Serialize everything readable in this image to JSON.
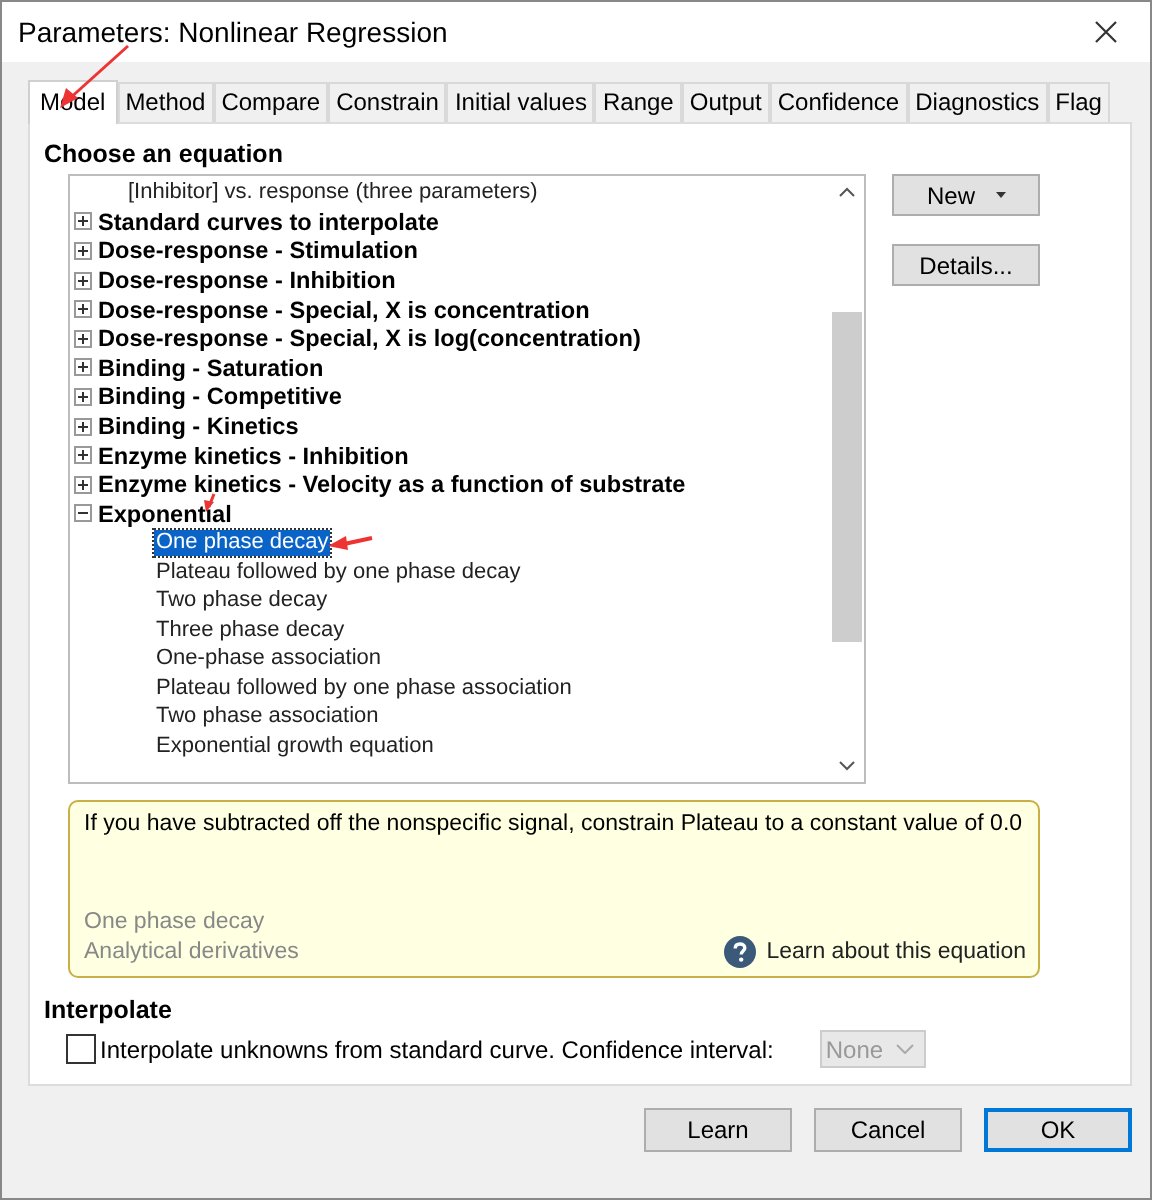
{
  "window": {
    "title": "Parameters: Nonlinear Regression"
  },
  "tabs": [
    {
      "label": "Model",
      "selected": true
    },
    {
      "label": "Method",
      "selected": false
    },
    {
      "label": "Compare",
      "selected": false
    },
    {
      "label": "Constrain",
      "selected": false
    },
    {
      "label": "Initial values",
      "selected": false
    },
    {
      "label": "Range",
      "selected": false
    },
    {
      "label": "Output",
      "selected": false
    },
    {
      "label": "Confidence",
      "selected": false
    },
    {
      "label": "Diagnostics",
      "selected": false
    },
    {
      "label": "Flag",
      "selected": false
    }
  ],
  "equation_section": {
    "heading": "Choose an equation",
    "tree": [
      {
        "kind": "leaf",
        "label": "[Inhibitor] vs. response (three parameters)",
        "selected": false
      },
      {
        "kind": "group",
        "label": "Standard curves to interpolate",
        "expanded": false
      },
      {
        "kind": "group",
        "label": "Dose-response - Stimulation",
        "expanded": false
      },
      {
        "kind": "group",
        "label": "Dose-response - Inhibition",
        "expanded": false
      },
      {
        "kind": "group",
        "label": "Dose-response - Special, X is concentration",
        "expanded": false
      },
      {
        "kind": "group",
        "label": "Dose-response - Special, X is log(concentration)",
        "expanded": false
      },
      {
        "kind": "group",
        "label": "Binding - Saturation",
        "expanded": false
      },
      {
        "kind": "group",
        "label": "Binding - Competitive",
        "expanded": false
      },
      {
        "kind": "group",
        "label": "Binding - Kinetics",
        "expanded": false
      },
      {
        "kind": "group",
        "label": "Enzyme kinetics - Inhibition",
        "expanded": false
      },
      {
        "kind": "group",
        "label": "Enzyme kinetics - Velocity as a function of substrate",
        "expanded": false
      },
      {
        "kind": "group",
        "label": "Exponential",
        "expanded": true,
        "children": [
          {
            "kind": "leaf",
            "label": "One phase decay",
            "selected": true
          },
          {
            "kind": "leaf",
            "label": "Plateau followed by one phase decay",
            "selected": false
          },
          {
            "kind": "leaf",
            "label": "Two phase decay",
            "selected": false
          },
          {
            "kind": "leaf",
            "label": "Three phase decay",
            "selected": false
          },
          {
            "kind": "leaf",
            "label": "One-phase association",
            "selected": false
          },
          {
            "kind": "leaf",
            "label": "Plateau followed by one phase association",
            "selected": false
          },
          {
            "kind": "leaf",
            "label": "Two phase association",
            "selected": false
          },
          {
            "kind": "leaf",
            "label": "Exponential growth equation",
            "selected": false
          }
        ]
      }
    ],
    "buttons": [
      {
        "label": "New",
        "dropdown": true
      },
      {
        "label": "Details...",
        "dropdown": false
      }
    ],
    "info": {
      "hint": "If you have subtracted off the nonspecific signal, constrain Plateau to a constant value of 0.0",
      "equation": "One phase decay",
      "derivatives": "Analytical derivatives",
      "link": "Learn about this equation"
    }
  },
  "interpolate": {
    "heading": "Interpolate",
    "checkbox": {
      "label": "Interpolate unknowns from standard curve. Confidence interval:",
      "checked": false
    },
    "dropdown": {
      "value": "None",
      "disabled": true
    }
  },
  "buttons": [
    {
      "label": "Learn",
      "default": false
    },
    {
      "label": "Cancel",
      "default": false
    },
    {
      "label": "OK",
      "default": true
    }
  ]
}
